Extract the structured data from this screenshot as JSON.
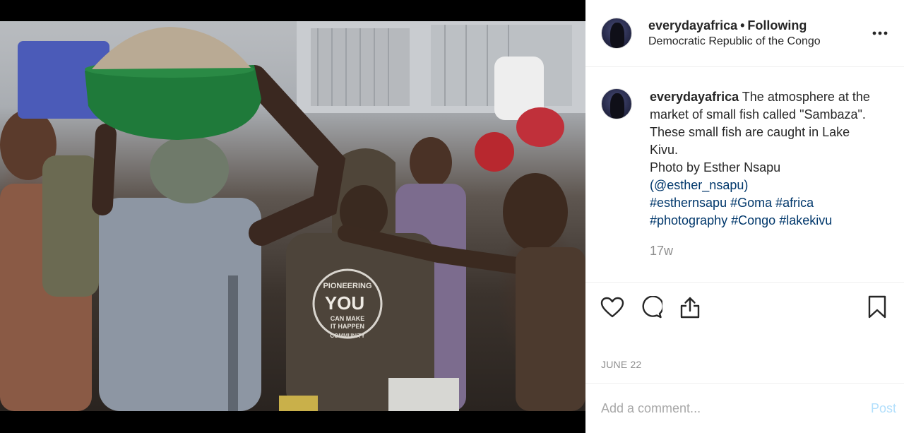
{
  "header": {
    "username": "everydayafrica",
    "separator": "•",
    "follow_status": "Following",
    "location": "Democratic Republic of the Congo",
    "more_icon": "more-horizontal-icon"
  },
  "caption": {
    "username": "everydayafrica",
    "text_line1": "The atmosphere at the",
    "text_line2": "market of small fish called \"Sambaza\".",
    "text_line3": "These small fish are caught in Lake",
    "text_line4": "Kivu.",
    "credit": "Photo by Esther Nsapu",
    "handle": "(@esther_nsapu)",
    "hashtags_line1": [
      "#esthernsapu",
      "#Goma",
      "#africa"
    ],
    "hashtags_line2": [
      "#photography",
      "#Congo",
      "#lakekivu"
    ],
    "age": "17w"
  },
  "actions": {
    "like_icon": "heart-icon",
    "comment_icon": "comment-icon",
    "share_icon": "share-icon",
    "save_icon": "bookmark-icon"
  },
  "post_date": "JUNE 22",
  "comment_box": {
    "placeholder": "Add a comment...",
    "post_label": "Post"
  },
  "photo": {
    "shirt_text_1": "PIONEERING",
    "shirt_text_2": "YOU",
    "shirt_text_3": "CAN MAKE",
    "shirt_text_4": "IT HAPPEN",
    "shirt_text_5": "COMMUNITY"
  },
  "colors": {
    "link": "#00376b",
    "muted": "#8e8e8e",
    "post_disabled": "#b2dffc",
    "basin_green": "#1f7a3a"
  }
}
